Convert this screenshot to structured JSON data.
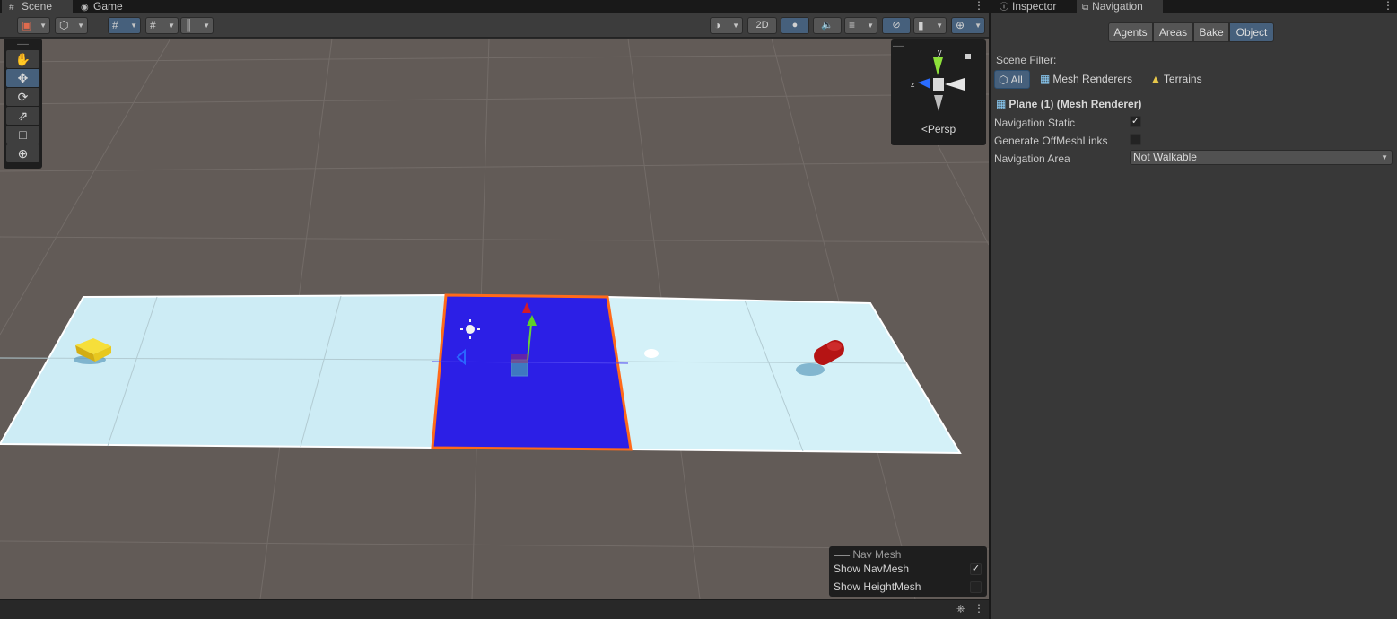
{
  "scene_window": {
    "tabs": [
      {
        "label": "Scene",
        "icon": "grid-icon"
      },
      {
        "label": "Game",
        "icon": "gamepad-icon"
      }
    ],
    "toolbar": {
      "two_d_label": "2D"
    },
    "gizmo": {
      "projection_label": "Persp",
      "axis_y": "y",
      "axis_z": "z"
    },
    "navmesh_overlay": {
      "title": "Nav Mesh",
      "options": [
        {
          "label": "Show NavMesh",
          "checked": true
        },
        {
          "label": "Show HeightMesh",
          "checked": false
        }
      ]
    }
  },
  "inspector_window": {
    "tabs": [
      {
        "label": "Inspector",
        "icon": "info-icon"
      },
      {
        "label": "Navigation",
        "icon": "navigation-icon"
      }
    ],
    "segments": [
      "Agents",
      "Areas",
      "Bake",
      "Object"
    ],
    "active_segment": "Object",
    "scene_filter": {
      "label": "Scene Filter:",
      "options": [
        "All",
        "Mesh Renderers",
        "Terrains"
      ],
      "selected": "All"
    },
    "object": {
      "title": "Plane (1) (Mesh Renderer)",
      "fields": [
        {
          "label": "Navigation Static",
          "type": "checkbox",
          "checked": true
        },
        {
          "label": "Generate OffMeshLinks",
          "type": "checkbox",
          "checked": false
        },
        {
          "label": "Navigation Area",
          "type": "dropdown",
          "value": "Not Walkable"
        }
      ]
    }
  },
  "colors": {
    "selection_accent": "#46607c",
    "navmesh_fill": "#cfeef6",
    "not_walkable_fill": "#2a1fe0",
    "selection_outline": "#ff6a1a",
    "cube": "#e8c81f",
    "capsule": "#b51414"
  }
}
